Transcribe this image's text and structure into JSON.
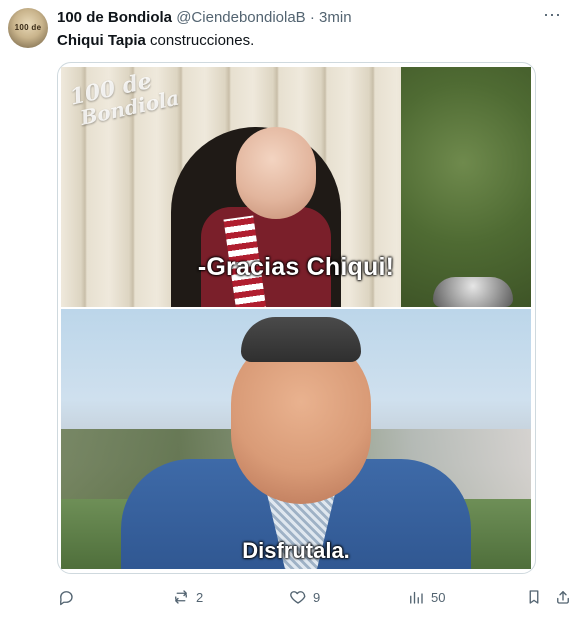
{
  "tweet": {
    "author": {
      "display_name": "100 de Bondiola",
      "handle": "@CiendebondiolaB",
      "time": "3min",
      "avatar_text": "100 de"
    },
    "text": {
      "bold": "Chiqui Tapia",
      "rest": " construcciones."
    },
    "media": {
      "watermark_line1": "100 de",
      "watermark_line2": "Bondiola",
      "subtitle_top": "-Gracias Chiqui!",
      "subtitle_bottom": "Disfrutala."
    },
    "actions": {
      "reply_icon": "reply-icon",
      "retweet_icon": "retweet-icon",
      "retweet_count": "2",
      "like_icon": "heart-icon",
      "like_count": "9",
      "views_icon": "views-icon",
      "views_count": "50",
      "bookmark_icon": "bookmark-icon",
      "share_icon": "share-icon"
    }
  },
  "colors": {
    "text": "#0f1419",
    "secondary": "#536471",
    "border": "#cfd9de",
    "background": "#ffffff"
  }
}
